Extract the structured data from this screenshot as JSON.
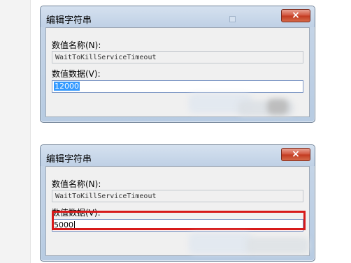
{
  "dialogs": [
    {
      "title": "编辑字符串",
      "close_label": "×",
      "value_name_label": "数值名称(N):",
      "value_name": "WaitToKillServiceTimeout",
      "value_data_label": "数值数据(V):",
      "value_data": "12000",
      "value_data_selected": true
    },
    {
      "title": "编辑字符串",
      "close_label": "×",
      "value_name_label": "数值名称(N):",
      "value_name": "WaitToKillServiceTimeout",
      "value_data_label": "数值数据(V):",
      "value_data": "5000",
      "value_data_selected": false
    }
  ],
  "colors": {
    "highlight_box": "#d71a1a",
    "selection": "#3399ff"
  }
}
